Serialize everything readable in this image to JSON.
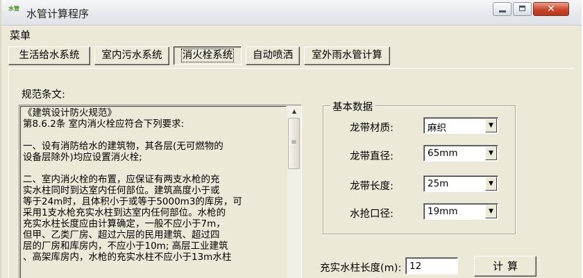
{
  "window": {
    "title": "水管计算程序",
    "icon": "app-icon",
    "icon_text": "水管"
  },
  "menu": {
    "items": [
      "菜单"
    ]
  },
  "tabs": [
    {
      "label": "生活给水系统",
      "active": false
    },
    {
      "label": "室内污水系统",
      "active": false
    },
    {
      "label": "消火栓系统",
      "active": true
    },
    {
      "label": "自动喷洒",
      "active": false
    },
    {
      "label": "室外雨水管计算",
      "active": false
    }
  ],
  "spec": {
    "label": "规范条文:",
    "lines": [
      "《建筑设计防火规范》",
      "第8.6.2条 室内消火栓应符合下列要求:",
      "",
      "一、设有消防给水的建筑物，其各层(无可燃物的",
      "设备层除外)均应设置消火栓;",
      "",
      "二、室内消火栓的布置，应保证有两支水枪的充",
      "实水柱同时到达室内任何部位。建筑高度小于或",
      "等于24m时，且体积小于或等于5000m3的库房，可",
      "采用1支水枪充实水柱到达室内任何部位。水枪的",
      "充实水柱长度应由计算确定，一般不应小于7m，",
      "但甲、乙类厂房、超过六层的民用建筑、超过四",
      "层的厂房和库房内，不应小于10m; 高层工业建筑",
      "、高架库房内，水枪的充实水柱不应小于13m水柱"
    ]
  },
  "basic_data": {
    "title": "基本数据",
    "fields": [
      {
        "label": "龙带材质:",
        "value": "麻织"
      },
      {
        "label": "龙带直径:",
        "value": "65mm"
      },
      {
        "label": "龙带长度:",
        "value": "25m"
      },
      {
        "label": "水抢口径:",
        "value": "19mm"
      }
    ]
  },
  "calc": {
    "length_label": "充实水柱长度(m):",
    "length_value": "12",
    "button_label": "计算"
  }
}
